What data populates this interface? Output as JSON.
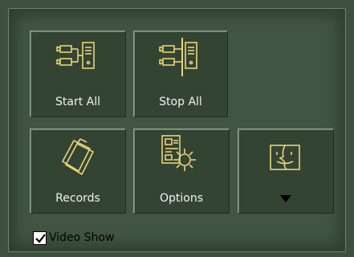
{
  "buttons": {
    "start_all": {
      "label": "Start All",
      "icon": "camera-server-icon"
    },
    "stop_all": {
      "label": "Stop All",
      "icon": "camera-server-stop-icon"
    },
    "records": {
      "label": "Records",
      "icon": "folder-icon"
    },
    "options": {
      "label": "Options",
      "icon": "settings-gear-icon"
    },
    "finder": {
      "icon": "finder-face-icon",
      "dropdown": "dropdown-arrow-icon"
    }
  },
  "video_show": {
    "label": "Video Show",
    "checked": true
  },
  "colors": {
    "accent": "#e8d27a",
    "panel": "#425542",
    "button": "#334433"
  }
}
